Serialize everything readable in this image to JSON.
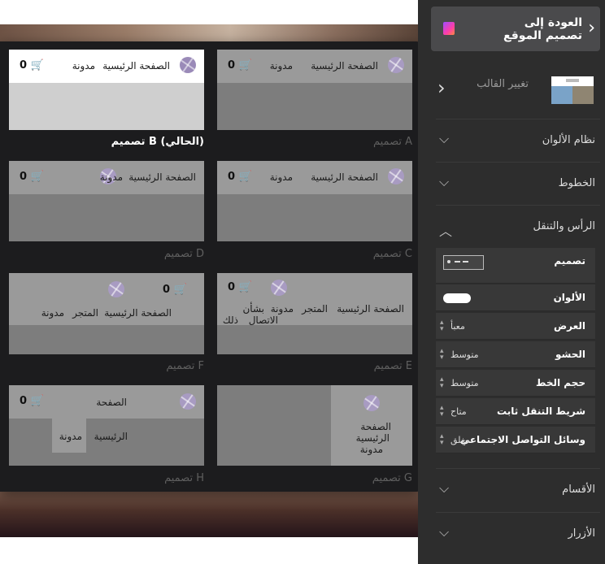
{
  "designs": [
    {
      "id": "a",
      "caption": "تصميم A",
      "logo": "basketball-logo-icon",
      "home": "الصفحة الرئيسية",
      "blog": "مدونة",
      "cart_count": "0",
      "current": false
    },
    {
      "id": "b",
      "caption": "تصميم B (الحالي)",
      "logo": "basketball-logo-icon",
      "home": "الصفحة الرئيسية",
      "blog": "مدونة",
      "cart_count": "0",
      "current": true
    },
    {
      "id": "c",
      "caption": "تصميم C",
      "home": "الصفحة الرئيسية",
      "blog": "مدونة",
      "cart_count": "0"
    },
    {
      "id": "d",
      "caption": "تصميم D",
      "home": "الصفحة الرئيسية",
      "blog": "مدونة",
      "cart_count": "0"
    },
    {
      "id": "e",
      "caption": "تصميم E",
      "home": "الصفحة الرئيسية",
      "store": "المتجر",
      "blog": "مدونة",
      "about": "بشأن",
      "that": "ذلك",
      "contact": "الاتصال",
      "cart_count": "0"
    },
    {
      "id": "f",
      "caption": "تصميم F",
      "home": "الصفحة الرئيسية",
      "store": "المتجر",
      "blog": "مدونة",
      "cart_count": "0"
    },
    {
      "id": "g",
      "caption": "تصميم G",
      "page": "الصفحة",
      "home_word": "الرئيسية",
      "blog": "مدونة"
    },
    {
      "id": "h",
      "caption": "تصميم H",
      "page": "الصفحة",
      "home_word": "الرئيسية",
      "blog": "مدونة",
      "cart_count": "0"
    }
  ],
  "panel": {
    "back_label": "العودة إلى تصميم الموقع",
    "back_icon": "chevron-left-icon",
    "template_label": "تغيير القالب",
    "sections": {
      "colors": "نظام الألوان",
      "fonts": "الخطوط",
      "header": "الرأس والتنقل",
      "sections": "الأقسام",
      "buttons": "الأزرار"
    },
    "header_settings": [
      {
        "key": "تصميم",
        "value": ""
      },
      {
        "key": "الألوان",
        "value": ""
      },
      {
        "key": "العرض",
        "value": "معبأ"
      },
      {
        "key": "الحشو",
        "value": "متوسط"
      },
      {
        "key": "حجم الخط",
        "value": "متوسط"
      },
      {
        "key": "شريط التنقل ثابت",
        "value": "متاح"
      },
      {
        "key": "وسائل التواصل الاجتماعي",
        "value": "مغلق"
      }
    ]
  },
  "colors": {
    "panel_bg": "#2d2d2d",
    "popover_bg": "#1c1c1e",
    "logo": "#a89bc2"
  }
}
